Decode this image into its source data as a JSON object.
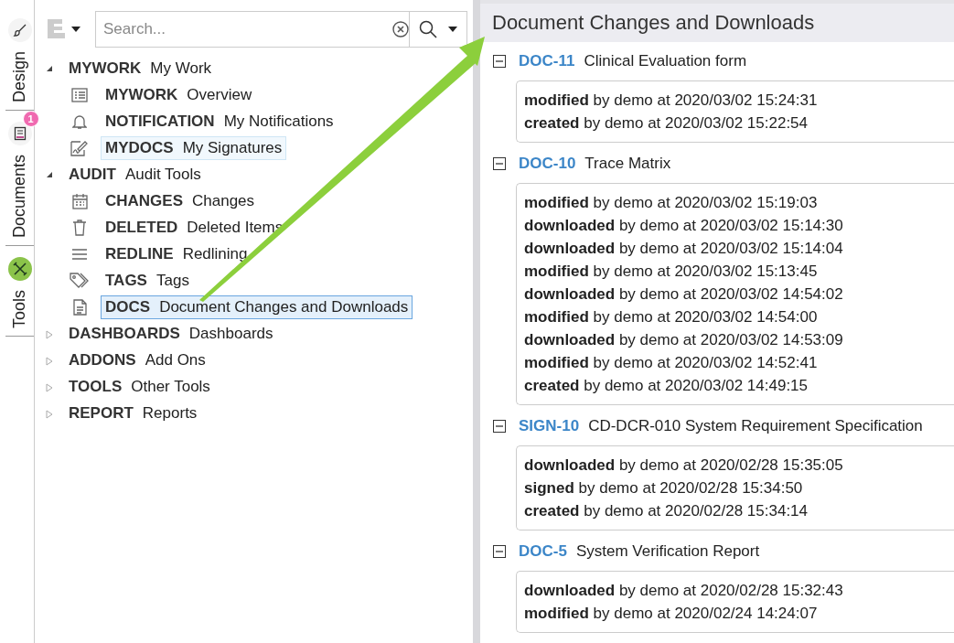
{
  "rail": {
    "tabs": [
      {
        "label": "Design",
        "selected": false
      },
      {
        "label": "Documents",
        "selected": false,
        "badge": "1"
      },
      {
        "label": "Tools",
        "selected": true
      }
    ]
  },
  "search": {
    "placeholder": "Search..."
  },
  "tree": [
    {
      "code": "MYWORK",
      "label": "My Work",
      "expanded": true,
      "children": [
        {
          "code": "MYWORK",
          "label": "Overview",
          "selected": false,
          "hovered": false
        },
        {
          "code": "NOTIFICATION",
          "label": "My Notifications",
          "selected": false,
          "hovered": false
        },
        {
          "code": "MYDOCS",
          "label": "My Signatures",
          "selected": false,
          "hovered": true
        }
      ]
    },
    {
      "code": "AUDIT",
      "label": "Audit Tools",
      "expanded": true,
      "children": [
        {
          "code": "CHANGES",
          "label": "Changes",
          "selected": false,
          "hovered": false
        },
        {
          "code": "DELETED",
          "label": "Deleted Items",
          "selected": false,
          "hovered": false
        },
        {
          "code": "REDLINE",
          "label": "Redlining",
          "selected": false,
          "hovered": false
        },
        {
          "code": "TAGS",
          "label": "Tags",
          "selected": false,
          "hovered": false
        },
        {
          "code": "DOCS",
          "label": "Document Changes and Downloads",
          "selected": true,
          "hovered": false
        }
      ]
    },
    {
      "code": "DASHBOARDS",
      "label": "Dashboards",
      "expanded": false
    },
    {
      "code": "ADDONS",
      "label": "Add Ons",
      "expanded": false
    },
    {
      "code": "TOOLS",
      "label": "Other Tools",
      "expanded": false
    },
    {
      "code": "REPORT",
      "label": "Reports",
      "expanded": false
    }
  ],
  "panel": {
    "title": "Document Changes and Downloads",
    "documents": [
      {
        "id": "DOC-11",
        "title": "Clinical Evaluation form",
        "expanded": true,
        "events": [
          "**modified** by demo at 2020/03/02 15:24:31",
          "**created** by demo at 2020/03/02 15:22:54"
        ]
      },
      {
        "id": "DOC-10",
        "title": "Trace Matrix",
        "expanded": true,
        "events": [
          "**modified** by demo at 2020/03/02 15:19:03",
          "**downloaded** by demo at 2020/03/02 15:14:30",
          "**downloaded** by demo at 2020/03/02 15:14:04",
          "**modified** by demo at 2020/03/02 15:13:45",
          "**downloaded** by demo at 2020/03/02 14:54:02",
          "**modified** by demo at 2020/03/02 14:54:00",
          "**downloaded** by demo at 2020/03/02 14:53:09",
          "**modified** by demo at 2020/03/02 14:52:41",
          "**created** by demo at 2020/03/02 14:49:15"
        ]
      },
      {
        "id": "SIGN-10",
        "title": "CD-DCR-010 System Requirement Specification",
        "expanded": true,
        "events": [
          "**downloaded** by demo at 2020/02/28 15:35:05",
          "**signed** by demo at 2020/02/28 15:34:50",
          "**created** by demo at 2020/02/28 15:34:14"
        ]
      },
      {
        "id": "DOC-5",
        "title": "System Verification Report",
        "expanded": true,
        "events": [
          "**downloaded** by demo at 2020/02/28 15:32:43",
          "**modified** by demo at 2020/02/24 14:24:07"
        ]
      }
    ]
  }
}
